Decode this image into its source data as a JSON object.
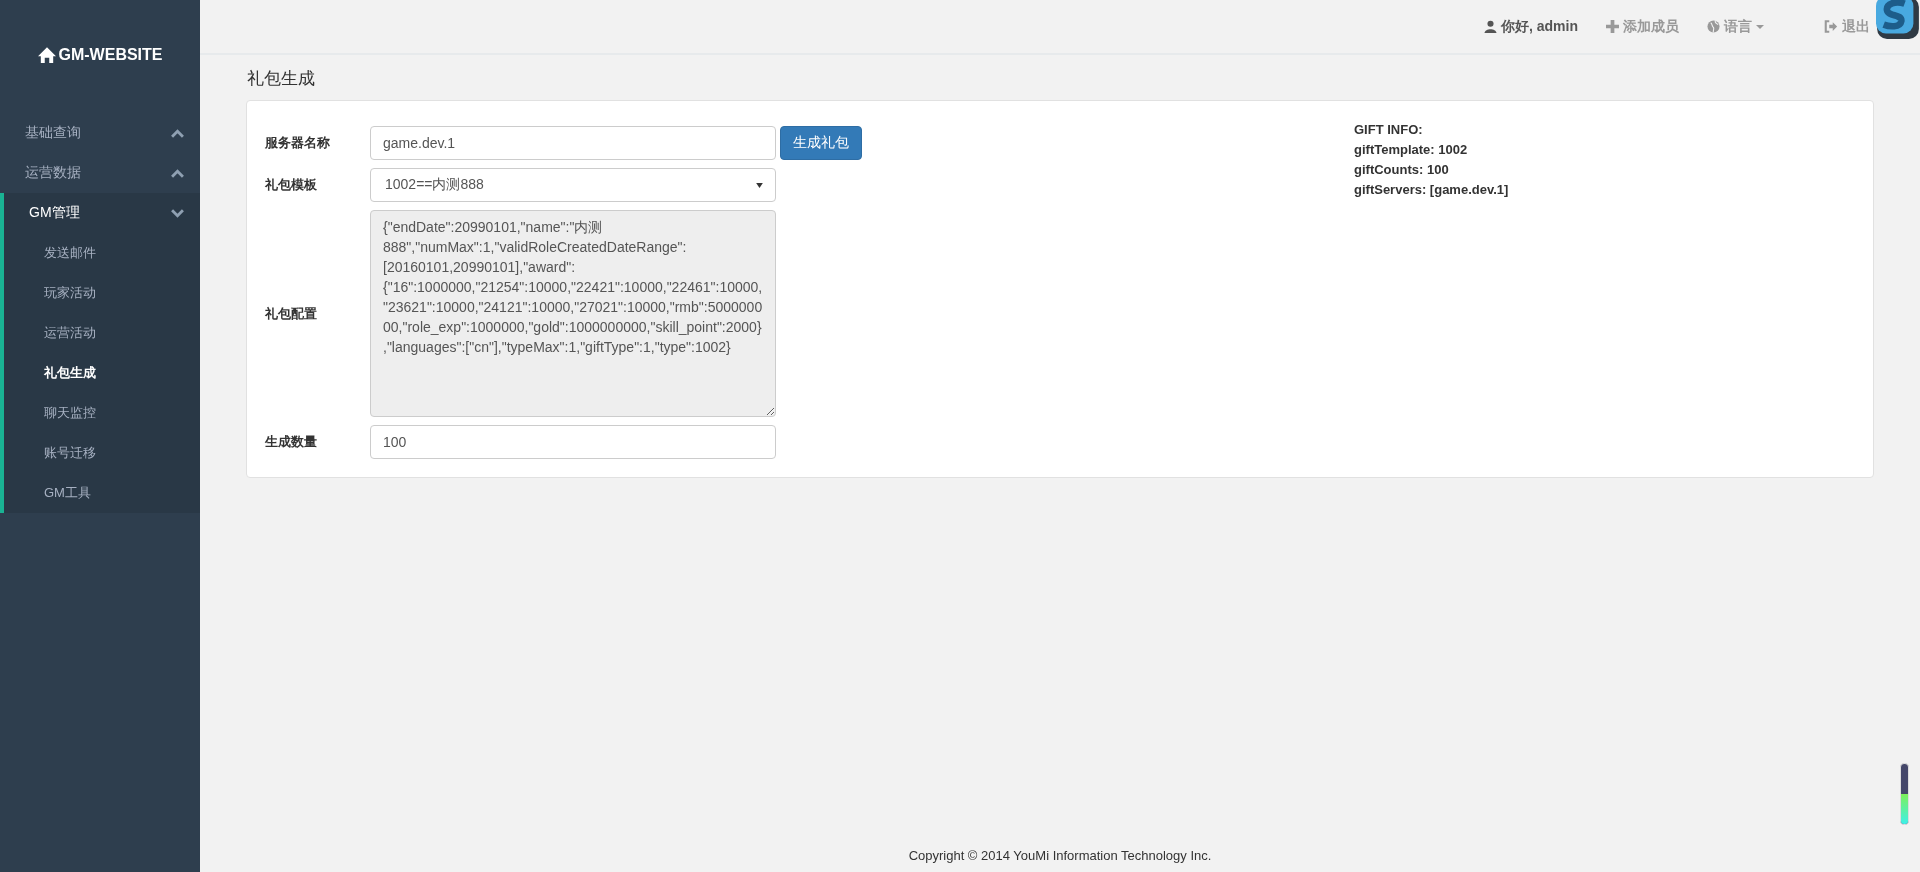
{
  "brand": {
    "title": "GM-WEBSITE"
  },
  "sidebar": {
    "items": [
      {
        "label": "基础查询",
        "expanded": false
      },
      {
        "label": "运营数据",
        "expanded": false
      },
      {
        "label": "GM管理",
        "expanded": true,
        "children": [
          {
            "label": "发送邮件",
            "selected": false
          },
          {
            "label": "玩家活动",
            "selected": false
          },
          {
            "label": "运营活动",
            "selected": false
          },
          {
            "label": "礼包生成",
            "selected": true
          },
          {
            "label": "聊天监控",
            "selected": false
          },
          {
            "label": "账号迁移",
            "selected": false
          },
          {
            "label": "GM工具",
            "selected": false
          }
        ]
      }
    ]
  },
  "topbar": {
    "items": [
      {
        "kind": "user",
        "label": "你好, admin"
      },
      {
        "kind": "add",
        "label": "添加成员"
      },
      {
        "kind": "language",
        "label": "语言"
      },
      {
        "kind": "logout",
        "label": "退出"
      }
    ]
  },
  "page_title": "礼包生成",
  "form": {
    "server": {
      "label": "服务器名称",
      "value": "game.dev.1"
    },
    "generate_button": "生成礼包",
    "template": {
      "label": "礼包模板",
      "value": "1002==内测888"
    },
    "config": {
      "label": "礼包配置",
      "value": "{\"endDate\":20990101,\"name\":\"内测888\",\"numMax\":1,\"validRoleCreatedDateRange\":[20160101,20990101],\"award\":{\"16\":1000000,\"21254\":10000,\"22421\":10000,\"22461\":10000,\"23621\":10000,\"24121\":10000,\"27021\":10000,\"rmb\":500000000,\"role_exp\":1000000,\"gold\":1000000000,\"skill_point\":2000},\"languages\":[\"cn\"],\"typeMax\":1,\"giftType\":1,\"type\":1002}"
    },
    "count": {
      "label": "生成数量",
      "value": "100"
    }
  },
  "gift_info": [
    "GIFT INFO:",
    "giftTemplate: 1002",
    "giftCounts: 100",
    "giftServers: [game.dev.1]"
  ],
  "footer": "Copyright © 2014 YouMi Information Technology Inc.",
  "meter_widget": {
    "level": 0.5
  }
}
